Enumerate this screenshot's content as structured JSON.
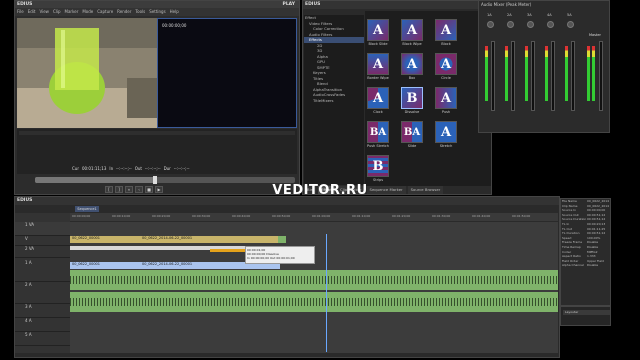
{
  "app": {
    "name": "EDIUS",
    "brand_right": "PLAY"
  },
  "preview": {
    "menu": [
      "File",
      "Edit",
      "View",
      "Clip",
      "Marker",
      "Mode",
      "Capture",
      "Render",
      "Tools",
      "Settings",
      "Help"
    ],
    "player_timecode": "00:00:00;00",
    "cur_label": "Cur",
    "cur_value": "00:01:11;13",
    "in_label": "In",
    "in_value": "--:--:--;--",
    "out_label": "Out",
    "out_value": "--:--:--;--",
    "dur_label": "Dur",
    "dur_value": "--:--:--;--"
  },
  "effects": {
    "title": "EDIUS",
    "tree": [
      "Effect",
      "Video Filters",
      "Color Correction",
      "Audio Filters",
      "Effects",
      "2D",
      "3D",
      "Alpha",
      "GPU",
      "SMPTE",
      "Keyers",
      "Titles",
      "Blend",
      "AlphaTransition",
      "AudioCrossFades",
      "TitleMixers"
    ],
    "tiles": [
      {
        "label": "Block Slide",
        "glyph": "A"
      },
      {
        "label": "Block Wipe",
        "glyph": "A"
      },
      {
        "label": "Block",
        "glyph": "A"
      },
      {
        "label": "Border Wipe",
        "glyph": "A"
      },
      {
        "label": "Box",
        "glyph": "A"
      },
      {
        "label": "Circle",
        "glyph": "A"
      },
      {
        "label": "Clock",
        "glyph": "A"
      },
      {
        "label": "Dissolve",
        "glyph": "B"
      },
      {
        "label": "Push",
        "glyph": "A"
      },
      {
        "label": "Push Stretch",
        "glyph": "BA"
      },
      {
        "label": "Slide",
        "glyph": "BA"
      },
      {
        "label": "Stretch",
        "glyph": "A"
      },
      {
        "label": "Strips",
        "glyph": "B"
      }
    ],
    "tabs": [
      "Bin",
      "Effect",
      "Clip Marker",
      "Sequence Marker",
      "Source Browser"
    ]
  },
  "mixer": {
    "title": "Audio Mixer (Peak Meter)",
    "master_label": "Master",
    "channels": [
      "1A",
      "2A",
      "3A",
      "4A",
      "5A"
    ]
  },
  "watermark": "VEDITOR.RU",
  "timeline": {
    "tab": "Sequence1",
    "tracks": [
      "1 VA",
      "V",
      "2 VA",
      "1 A",
      "2 A",
      "3 A",
      "4 A",
      "5 A"
    ],
    "ruler_ticks": [
      "00:00:00;00",
      "00:00:10;00",
      "00:00:20;00",
      "00:00:30;00",
      "00:00:40;00",
      "00:00:50;00",
      "00:01:00;00",
      "00:01:10;00",
      "00:01:20;00",
      "00:01:30;00",
      "00:01:40;00",
      "00:01:50;00"
    ],
    "clip1": "00_0622_00001",
    "clip2": "00_0622_2014-06-22_00001",
    "clip3": "00_0622_00001",
    "clip4": "00_0622_2014-06-22_00001",
    "tooltip": [
      "00:00:01;00",
      "00:00:00;00 Dissolve",
      "In 00:00:00;00 Out 00:00:01;00"
    ]
  },
  "info": {
    "rows": [
      [
        "File Name",
        "00_0622_2014"
      ],
      [
        "Clip Name",
        "00_0622_2014"
      ],
      [
        "Source In",
        "00:00:00;00"
      ],
      [
        "Source Out",
        "00:00:51;12"
      ],
      [
        "Source Duration",
        "00:00:51;12"
      ],
      [
        "TL In",
        "00:00:20;13"
      ],
      [
        "TL Out",
        "00:01:11;25"
      ],
      [
        "TL Duration",
        "00:00:51;12"
      ],
      [
        "Speed",
        "100.00%"
      ],
      [
        "Freeze Frame",
        "Disable"
      ],
      [
        "Time Remap",
        "Disable"
      ],
      [
        "Codec",
        "MPEG2"
      ],
      [
        "Aspect Ratio",
        "1.333"
      ],
      [
        "Field Order",
        "Upper Field"
      ],
      [
        "Alpha Channel",
        "Disable"
      ]
    ],
    "mini_label": "Layouter"
  }
}
